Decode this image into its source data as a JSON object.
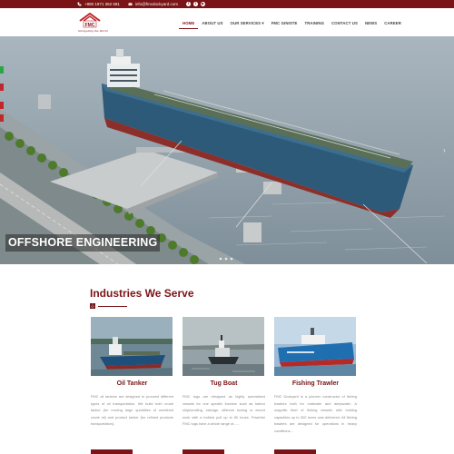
{
  "topbar": {
    "phone": "+880 1971 362 581",
    "email": "info@fmcdockyard.com",
    "social": [
      "facebook-icon",
      "twitter-icon",
      "youtube-icon"
    ]
  },
  "header": {
    "logo_text": "FMC",
    "logo_tagline": "Navigating the World"
  },
  "nav": {
    "items": [
      {
        "label": "HOME",
        "active": true
      },
      {
        "label": "ABOUT US"
      },
      {
        "label": "OUR SERVICES ▾"
      },
      {
        "label": "FMC GINISTE"
      },
      {
        "label": "TRAINING"
      },
      {
        "label": "CONTACT US"
      },
      {
        "label": "NEWS"
      },
      {
        "label": "CAREER"
      }
    ]
  },
  "hero": {
    "caption": "OFFSHORE ENGINEERING"
  },
  "section": {
    "title": "Industries We Serve"
  },
  "cards": [
    {
      "title": "Oil Tanker",
      "text": "FMC oil tankers are designed to proceed different types of oil transportation. We build both crude tanker (for moving large quantities of unrefined crude oil) and product tanker (for refined products transportation)."
    },
    {
      "title": "Tug Boat",
      "text": "FMC tugs are designed as highly specialized vessels for one specific function such as harbor shiphandling, salvage, offshore towing or escort work with a bollard pull up to 80 tones. Powerful FMC tugs have a whole range of......"
    },
    {
      "title": "Fishing Trawler",
      "text": "FMC Dockyard is a pioneer constructor of fishing trawlers both for midwater and deepwater. A magnific fleet of fishing vessels with holding capacities up to 300 tones was delivered. All fishing trawlers are designed for operations in heavy conditions..."
    }
  ],
  "colors": {
    "brand": "#7a1417",
    "nav_text": "#444444",
    "body_text": "#8a8a8a"
  }
}
